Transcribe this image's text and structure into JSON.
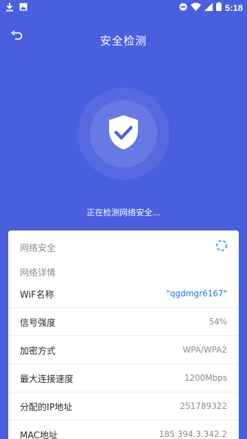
{
  "statusbar": {
    "time": "5:18",
    "left_icons": [
      "download-icon",
      "image-icon"
    ],
    "right_icons": [
      "dnd-icon",
      "wifi-icon",
      "signal-icon",
      "battery-icon"
    ]
  },
  "header": {
    "title": "安全检测",
    "back_icon": "back-arrow-icon"
  },
  "scan": {
    "status_text": "正在检测网络安全...",
    "shield_icon": "shield-check-icon"
  },
  "card": {
    "security_label": "网络安全",
    "loading_icon": "spinner-icon",
    "details_header": "网络详情",
    "rows": [
      {
        "label": "WiF名称",
        "value": "\"qgdmgr6167\""
      },
      {
        "label": "信号强度",
        "value": "54%"
      },
      {
        "label": "加密方式",
        "value": "WPA/WPA2"
      },
      {
        "label": "最大连接速度",
        "value": "1200Mbps"
      },
      {
        "label": "分配的IP地址",
        "value": "251789322"
      },
      {
        "label": "MAC地址",
        "value": "185.394.3.342.2"
      }
    ]
  },
  "colors": {
    "background": "#4a5fde",
    "accent": "#1a73e8",
    "spinner": "#29a3e8"
  }
}
